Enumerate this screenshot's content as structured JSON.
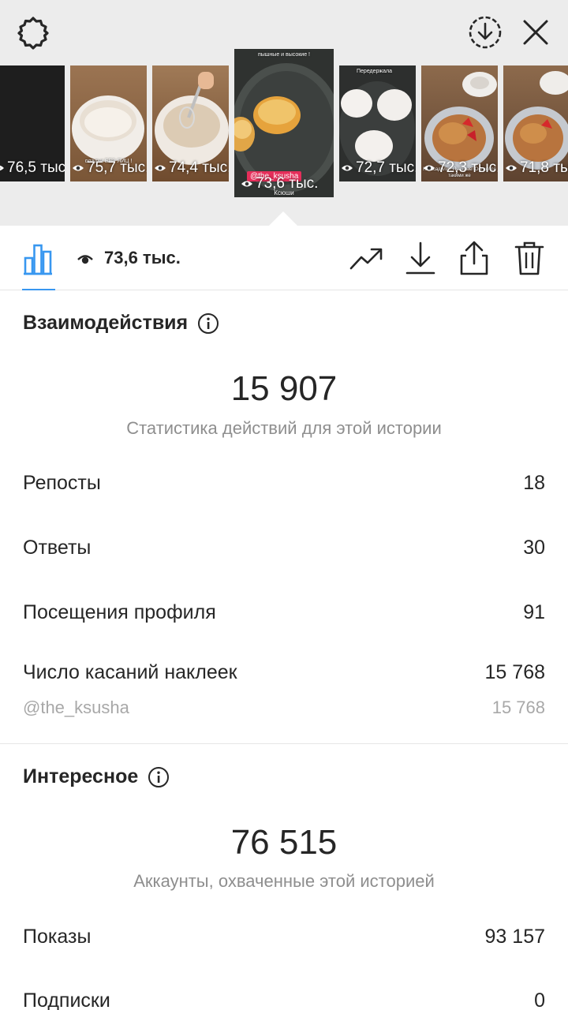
{
  "header": {
    "icons": [
      "settings-icon",
      "download-circle-icon",
      "close-icon"
    ]
  },
  "stories": [
    {
      "views": "76,5 тыс."
    },
    {
      "views": "75,7 тыс.",
      "caption": "оладьи БЕЗ ЯИЦ !"
    },
    {
      "views": "74,4 тыс."
    },
    {
      "views": "73,6 тыс.",
      "selected": true,
      "caption_top": "пышные и высокие !",
      "tag": "@the_ksusha",
      "caption_bottom": "Ксюши"
    },
    {
      "views": "72,7 тыс.",
      "caption_top": "Передержала"
    },
    {
      "views": "72,3 тыс.",
      "caption": "Не осадили ! Пышные! Остаются такими же"
    },
    {
      "views": "71,8 тыс."
    }
  ],
  "toolbar": {
    "views_label": "73,6 тыс.",
    "icons": [
      "insights-bar-chart-icon",
      "eye-icon",
      "trending-up-icon",
      "download-icon",
      "share-icon",
      "trash-icon"
    ]
  },
  "interactions": {
    "title": "Взаимодействия",
    "total": "15 907",
    "subtitle": "Статистика действий для этой истории",
    "rows": [
      {
        "label": "Репосты",
        "value": "18"
      },
      {
        "label": "Ответы",
        "value": "30"
      },
      {
        "label": "Посещения профиля",
        "value": "91"
      },
      {
        "label": "Число касаний наклеек",
        "value": "15 768"
      }
    ],
    "sticker": {
      "label": "@the_ksusha",
      "value": "15 768"
    }
  },
  "discovery": {
    "title": "Интересное",
    "total": "76 515",
    "subtitle": "Аккаунты, охваченные этой историей",
    "rows": [
      {
        "label": "Показы",
        "value": "93 157"
      },
      {
        "label": "Подписки",
        "value": "0"
      }
    ]
  },
  "colors": {
    "accent": "#3897f0",
    "text": "#262626",
    "muted": "#8e8e8e",
    "tag": "#e52e5a"
  }
}
